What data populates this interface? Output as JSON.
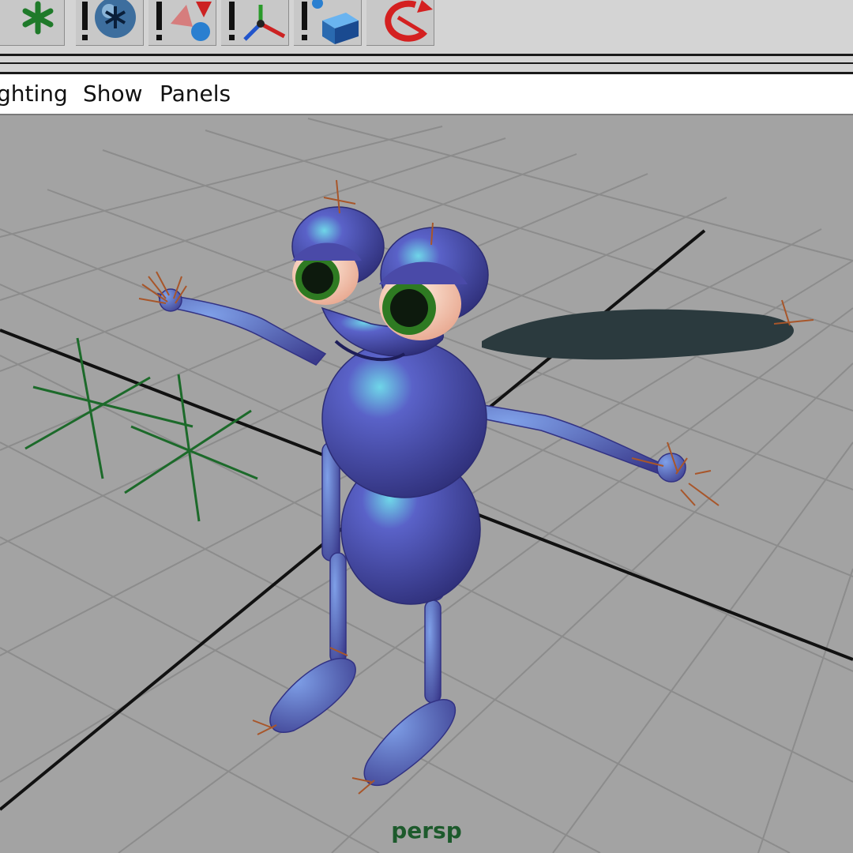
{
  "shelf": {
    "tools": [
      {
        "icon": "asterisk-icon",
        "tooltip": ""
      },
      {
        "icon": "solver-sphere-icon"
      },
      {
        "icon": "particle-field-icon"
      },
      {
        "icon": "joint-axis-icon"
      },
      {
        "icon": "cube-emitter-icon"
      },
      {
        "icon": "rotate-arrow-icon"
      }
    ]
  },
  "menubar": {
    "items": [
      "ghting",
      "Show",
      "Panels"
    ]
  },
  "viewport": {
    "camera_label": "persp",
    "grid_color": "#8e8e8e",
    "background": "#a3a3a3",
    "character_color": "#4f4fa8"
  }
}
